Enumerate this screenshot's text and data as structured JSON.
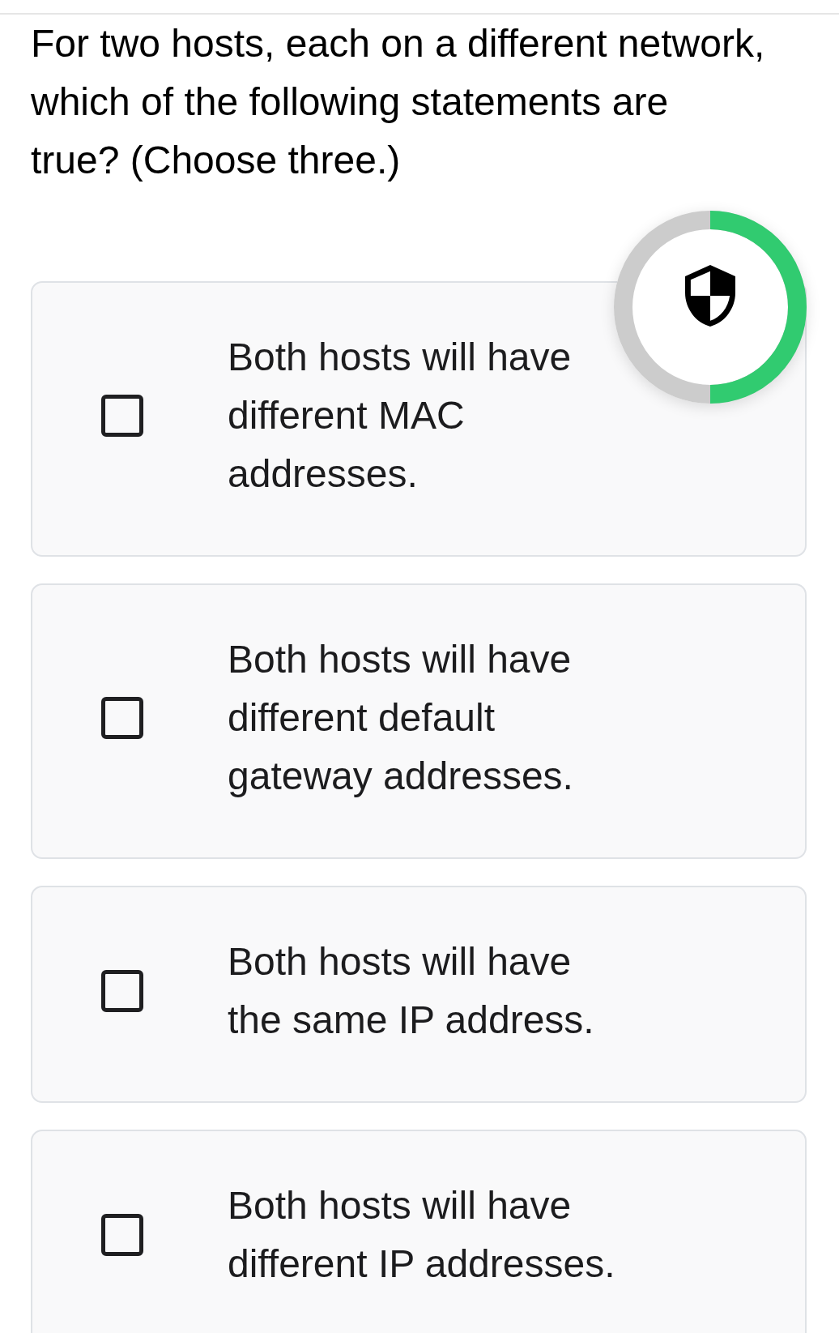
{
  "question": "For two hosts, each on a different network, which of the following statements are true? (Choose three.)",
  "progress": {
    "level": 0.5
  },
  "options": [
    {
      "text": "Both hosts will have different MAC addresses.",
      "checked": false
    },
    {
      "text": "Both hosts will have different default gateway addresses.",
      "checked": false
    },
    {
      "text": "Both hosts will have the same IP address.",
      "checked": false
    },
    {
      "text": "Both hosts will have different IP addresses.",
      "checked": false
    }
  ]
}
